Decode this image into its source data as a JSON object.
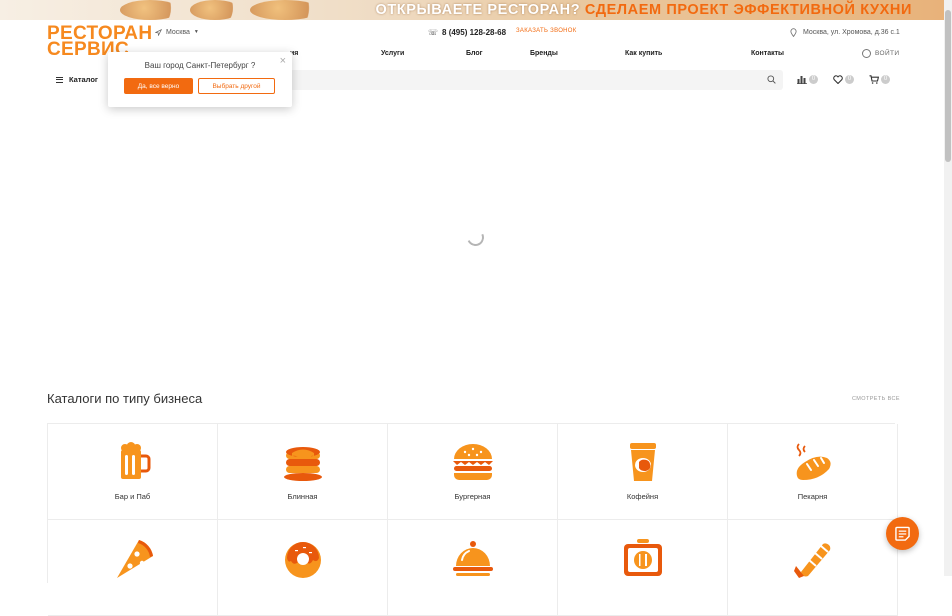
{
  "banner": {
    "text_white": "ОТКРЫВАЕТЕ РЕСТОРАН?",
    "text_orange": "СДЕЛАЕМ ПРОЕКТ ЭФФЕКТИВНОЙ КУХНИ"
  },
  "logo": {
    "line1": "РЕСТОРАН",
    "line2": "СЕРВИС"
  },
  "header": {
    "city": "Москва",
    "phone": "8 (495) 128-28-68",
    "callback": "заказать звонок",
    "address": "Москва, ул. Хромова, д.36 с.1",
    "login": "ВОЙТИ"
  },
  "nav": [
    {
      "label": "ия"
    },
    {
      "label": "Услуги"
    },
    {
      "label": "Блог"
    },
    {
      "label": "Бренды"
    },
    {
      "label": "Как купить"
    },
    {
      "label": "Контакты"
    }
  ],
  "catalog_label": "Каталог",
  "counters": {
    "compare": "0",
    "favorites": "0",
    "cart": "0"
  },
  "city_popup": {
    "question": "Ваш город Санкт-Петербург ?",
    "confirm": "Да, все верно",
    "choose_other": "Выбрать другой"
  },
  "business": {
    "title": "Каталоги по типу бизнеса",
    "see_all": "СМОТРЕТЬ ВСЕ",
    "items": [
      {
        "label": "Бар и Паб",
        "icon": "beer-mug-icon"
      },
      {
        "label": "Блинная",
        "icon": "pancakes-icon"
      },
      {
        "label": "Бургерная",
        "icon": "burger-icon"
      },
      {
        "label": "Кофейня",
        "icon": "coffee-cup-icon"
      },
      {
        "label": "Пекарня",
        "icon": "bread-icon"
      },
      {
        "label": "",
        "icon": "pizza-slice-icon"
      },
      {
        "label": "",
        "icon": "donut-icon"
      },
      {
        "label": "",
        "icon": "cloche-icon"
      },
      {
        "label": "",
        "icon": "menu-board-icon"
      },
      {
        "label": "",
        "icon": "shawarma-icon"
      }
    ]
  },
  "colors": {
    "accent": "#f26a10",
    "logo": "#f6891f",
    "icon_orange": "#f7941d",
    "icon_dark": "#e8590c"
  }
}
